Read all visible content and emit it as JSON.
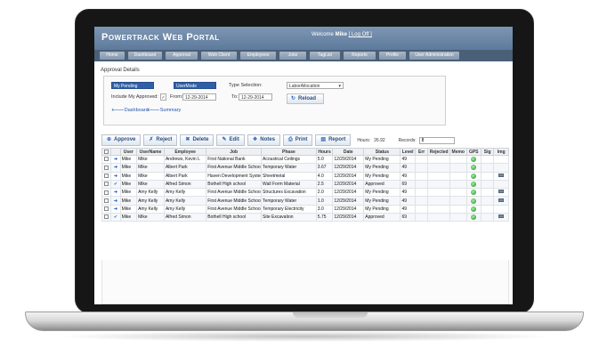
{
  "header": {
    "title": "Powertrack Web Portal",
    "welcome_prefix": "Welcome",
    "user": "Mike",
    "logoff": "[ Log Off ]"
  },
  "nav": [
    "Home",
    "Dashboard",
    "Approval",
    "Web Client",
    "Employees",
    "Jobs",
    "TagList",
    "Reports",
    "Profile",
    "User Administration"
  ],
  "section_title": "Approval Details",
  "filters": {
    "mode_a": "My Pending",
    "mode_b": "UserMode",
    "type_label": "Type Selection:",
    "type_value": "LaborAllocation",
    "include_label": "Include My Approved:",
    "include_checked": "✓",
    "from_label": "From:",
    "from_value": "12-29-2014",
    "to_label": "To:",
    "to_value": "12-29-2014",
    "reload_label": "Reload",
    "dashboard_link": "Dashboard",
    "summary_link": "Summary"
  },
  "toolbar": {
    "approve": "Approve",
    "reject": "Reject",
    "delete": "Delete",
    "edit": "Edit",
    "notes": "Notes",
    "print": "Print",
    "report": "Report",
    "hours_label": "Hours:",
    "hours_value": "26.92",
    "records_label": "Records:",
    "records_value": "8"
  },
  "table": {
    "headers": [
      "User",
      "UserName",
      "Employee",
      "Job",
      "Phase",
      "Hours",
      "Date",
      "Status",
      "Level",
      "Err",
      "Rejected",
      "Memo",
      "GPS",
      "Sig",
      "Img"
    ],
    "rows": [
      {
        "icon": "arrow",
        "user": "Mike",
        "username": "Mike",
        "employee": "Andrews, Kevin L",
        "job": "First National Bank",
        "phase": "Acoustical Ceilings",
        "hours": "5.0",
        "date": "12/29/2014",
        "status": "My Pending",
        "level": "49",
        "img": false
      },
      {
        "icon": "arrow",
        "user": "Mike",
        "username": "Mike",
        "employee": "Albert Park",
        "job": "First Avenue Middle School",
        "phase": "Temporary Water",
        "hours": "3.67",
        "date": "12/29/2014",
        "status": "My Pending",
        "level": "49",
        "img": false
      },
      {
        "icon": "arrow",
        "user": "Mike",
        "username": "Mike",
        "employee": "Albert Park",
        "job": "Haven Development System",
        "phase": "Sheetmetal",
        "hours": "4.0",
        "date": "12/29/2014",
        "status": "My Pending",
        "level": "49",
        "img": true
      },
      {
        "icon": "check",
        "user": "Mike",
        "username": "Mike",
        "employee": "Alfred Simon",
        "job": "Bothell High school",
        "phase": "Wall Form Material",
        "hours": "2.5",
        "date": "12/29/2014",
        "status": "Approved",
        "level": "69",
        "img": false
      },
      {
        "icon": "arrow",
        "user": "Mike",
        "username": "Amy Kelly",
        "employee": "Amy Kelly",
        "job": "First Avenue Middle School",
        "phase": "Structures Excavation",
        "hours": "2.0",
        "date": "12/29/2014",
        "status": "My Pending",
        "level": "49",
        "img": true
      },
      {
        "icon": "arrow",
        "user": "Mike",
        "username": "Amy Kelly",
        "employee": "Amy Kelly",
        "job": "First Avenue Middle School",
        "phase": "Temporary Water",
        "hours": "1.0",
        "date": "12/29/2014",
        "status": "My Pending",
        "level": "49",
        "img": true
      },
      {
        "icon": "arrow",
        "user": "Mike",
        "username": "Amy Kelly",
        "employee": "Amy Kelly",
        "job": "First Avenue Middle School",
        "phase": "Temporary Electricity",
        "hours": "3.0",
        "date": "12/29/2014",
        "status": "My Pending",
        "level": "49",
        "img": false
      },
      {
        "icon": "check",
        "user": "Mike",
        "username": "Mike",
        "employee": "Alfred Simon",
        "job": "Bothell High school",
        "phase": "Site Excavation",
        "hours": "5.75",
        "date": "12/29/2014",
        "status": "Approved",
        "level": "69",
        "img": true
      }
    ]
  }
}
